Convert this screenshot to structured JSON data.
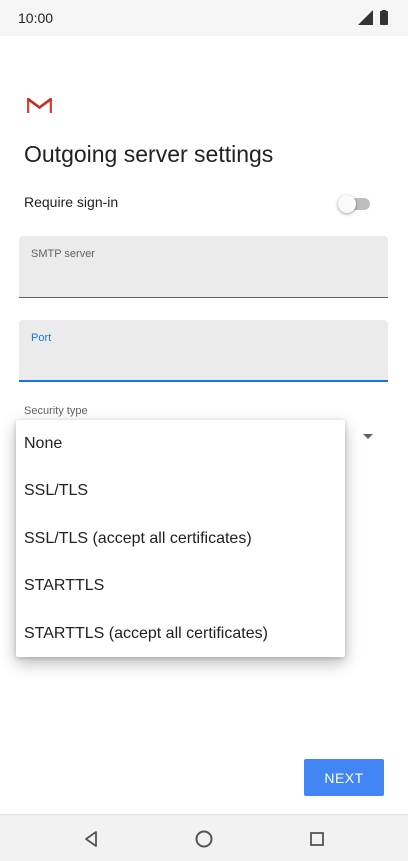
{
  "status_bar": {
    "time": "10:00",
    "icons": [
      "signal-icon",
      "battery-icon"
    ]
  },
  "app": {
    "logo": "gmail-logo",
    "title": "Outgoing server settings",
    "require_signin": {
      "label": "Require sign-in",
      "enabled": false
    },
    "smtp_server": {
      "label": "SMTP server",
      "value": ""
    },
    "port": {
      "label": "Port",
      "value": ""
    },
    "security_type": {
      "label": "Security type",
      "options": [
        "None",
        "SSL/TLS",
        "SSL/TLS (accept all certificates)",
        "STARTTLS",
        "STARTTLS (accept all certificates)"
      ]
    },
    "next_label": "NEXT"
  },
  "nav_bar": {
    "icons": [
      "back-icon",
      "home-icon",
      "recents-icon"
    ]
  },
  "colors": {
    "accent": "#1a73e8",
    "button": "#4285f4",
    "gmail_red": "#d44638"
  }
}
